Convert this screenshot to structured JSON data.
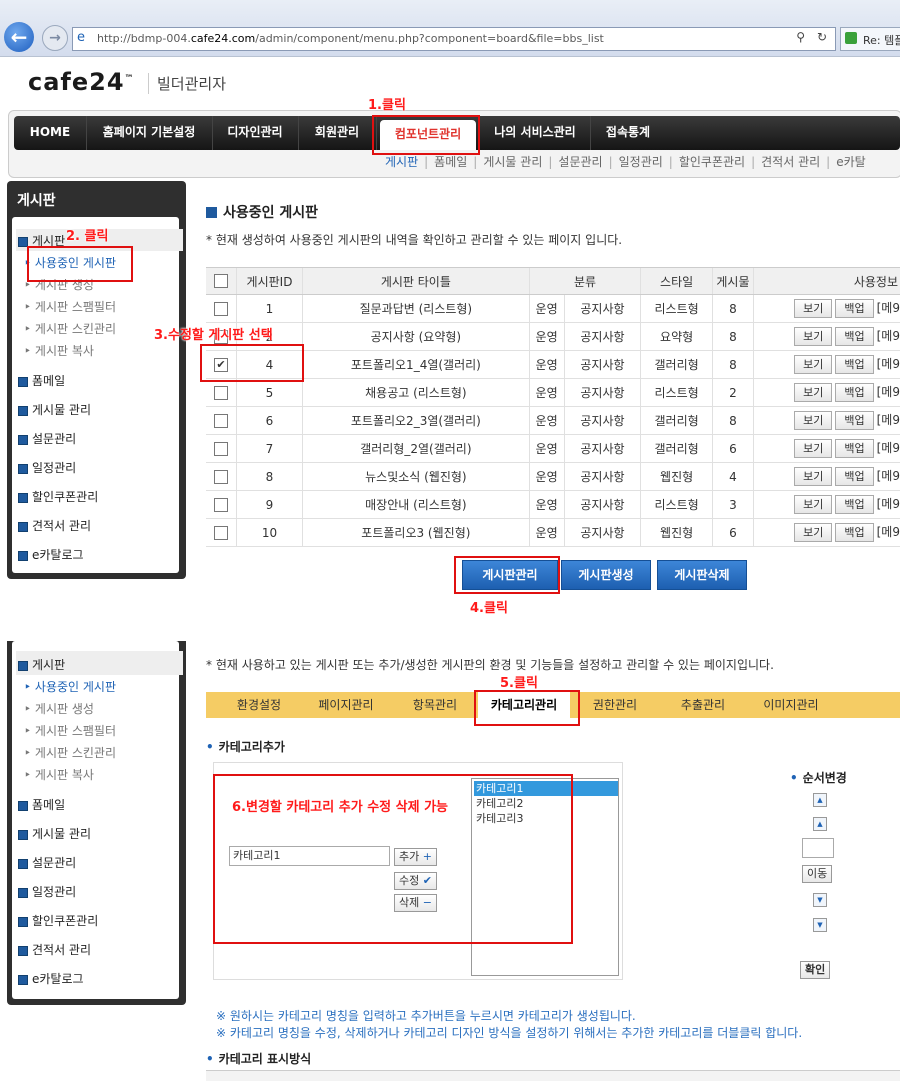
{
  "browser": {
    "url_prefix": "http://bdmp-004.",
    "url_domain": "cafe24.com",
    "url_suffix": "/admin/component/menu.php?component=board&file=bbs_list",
    "tab_label": "Re: 템플"
  },
  "logo": {
    "brand": "cafe24",
    "tm": "™",
    "subtitle": "빌더관리자"
  },
  "topnav": [
    "HOME",
    "홈페이지 기본설정",
    "디자인관리",
    "회원관리",
    "컴포넌트관리",
    "나의 서비스관리",
    "접속통계"
  ],
  "subnav": [
    "게시판",
    "폼메일",
    "게시물 관리",
    "설문관리",
    "일정관리",
    "할인쿠폰관리",
    "견적서 관리",
    "e카탈"
  ],
  "sidebar": {
    "title": "게시판",
    "group": "게시판",
    "subs": [
      "사용중인 게시판",
      "게시판 생성",
      "게시판 스팸필터",
      "게시판 스킨관리",
      "게시판 복사"
    ],
    "items": [
      "폼메일",
      "게시물 관리",
      "설문관리",
      "일정관리",
      "할인쿠폰관리",
      "견적서 관리",
      "e카탈로그"
    ]
  },
  "main": {
    "title": "사용중인 게시판",
    "desc": "* 현재 생성하여 사용중인 게시판의 내역을 확인하고 관리할 수 있는 페이지 입니다.",
    "headers": [
      "게시판ID",
      "게시판 타이틀",
      "분류",
      "스타일",
      "게시물",
      "사용정보"
    ],
    "rows": [
      {
        "id": "1",
        "title": "질문과답변 (리스트형)",
        "c1": "운영",
        "c2": "공지사항",
        "style": "리스트형",
        "count": "8",
        "checked": false
      },
      {
        "id": "2",
        "title": "공지사항 (요약형)",
        "c1": "운영",
        "c2": "공지사항",
        "style": "요약형",
        "count": "8",
        "checked": false
      },
      {
        "id": "4",
        "title": "포트폴리오1_4열(갤러리)",
        "c1": "운영",
        "c2": "공지사항",
        "style": "갤러리형",
        "count": "8",
        "checked": true
      },
      {
        "id": "5",
        "title": "채용공고 (리스트형)",
        "c1": "운영",
        "c2": "공지사항",
        "style": "리스트형",
        "count": "2",
        "checked": false
      },
      {
        "id": "6",
        "title": "포트폴리오2_3열(갤러리)",
        "c1": "운영",
        "c2": "공지사항",
        "style": "갤러리형",
        "count": "8",
        "checked": false
      },
      {
        "id": "7",
        "title": "갤러리형_2열(갤러리)",
        "c1": "운영",
        "c2": "공지사항",
        "style": "갤러리형",
        "count": "6",
        "checked": false
      },
      {
        "id": "8",
        "title": "뉴스및소식 (웹진형)",
        "c1": "운영",
        "c2": "공지사항",
        "style": "웹진형",
        "count": "4",
        "checked": false
      },
      {
        "id": "9",
        "title": "매장안내 (리스트형)",
        "c1": "운영",
        "c2": "공지사항",
        "style": "리스트형",
        "count": "3",
        "checked": false
      },
      {
        "id": "10",
        "title": "포트폴리오3 (웹진형)",
        "c1": "운영",
        "c2": "공지사항",
        "style": "웹진형",
        "count": "6",
        "checked": false
      }
    ],
    "view_label": "보기",
    "backup_label": "백업",
    "extra": "[메9",
    "buttons": [
      "게시판관리",
      "게시판생성",
      "게시판삭제"
    ]
  },
  "annotations": [
    "1.클릭",
    "2. 클릭",
    "3.수정할 게시판 선택",
    "4.클릭",
    "5.클릭",
    "6.변경할 카테고리 추가 수정 삭제 가능"
  ],
  "lower": {
    "desc": "* 현재 사용하고 있는 게시판 또는 추가/생성한 게시판의 환경 및 기능들을 설정하고 관리할 수 있는 페이지입니다.",
    "tabs": [
      "환경설정",
      "페이지관리",
      "항목관리",
      "카테고리관리",
      "권한관리",
      "추출관리",
      "이미지관리"
    ],
    "section1": "카테고리추가",
    "input_value": "카테고리1",
    "add_label": "추가",
    "edit_label": "수정",
    "delete_label": "삭제",
    "categories": [
      "카테고리1",
      "카테고리2",
      "카테고리3"
    ],
    "order_title": "순서변경",
    "move_label": "이동",
    "confirm_label": "확인",
    "notes": [
      "※ 원하시는 카테고리 명칭을 입력하고 추가버튼을 누르시면 카테고리가 생성됩니다.",
      "※ 카테고리 명칭을 수정, 삭제하거나 카테고리 디자인 방식을 설정하기 위해서는 추가한 카테고리를 더블클릭 합니다."
    ],
    "section2": "카테고리 표시방식"
  },
  "colors": {
    "accent": "#1f5a9e",
    "annotation": "#e01010",
    "tabbar": "#f5cc64"
  }
}
